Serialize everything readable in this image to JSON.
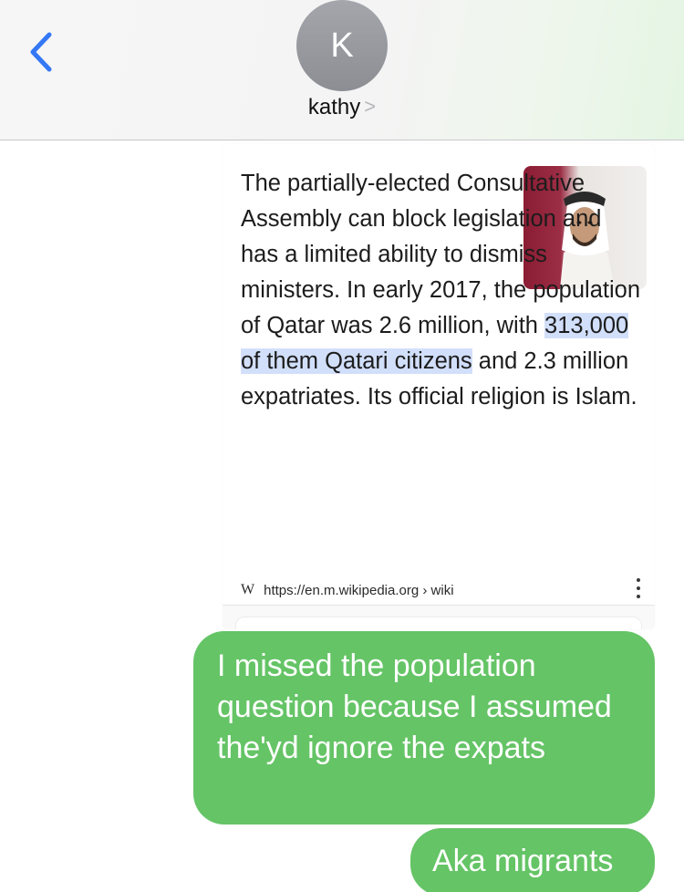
{
  "header": {
    "back_icon": "chevron-left-icon",
    "avatar_initial": "K",
    "contact_name": "kathy",
    "contact_chevron": ">"
  },
  "colors": {
    "accent_blue": "#3478f6",
    "bubble_green": "#65c466",
    "avatar_gray": "#9a9ca2",
    "highlight": "#d2dffb"
  },
  "shared_card": {
    "text_before_highlight": "The partially-elected Consultative Assembly can block legislation and has a limited ability to dismiss ministers. In early 2017, the population of Qatar was 2.6 million, with ",
    "text_highlight": "313,000 of them Qatari citizens",
    "text_after_highlight": " and 2.3 million expatriates. Its official religion is Islam.",
    "source_icon": "W",
    "source_url": "https://en.m.wikipedia.org › wiki",
    "more_icon": "more-vertical-icon"
  },
  "messages": [
    {
      "text": "I missed the population question because I assumed the'yd ignore the expats",
      "sender": "me"
    },
    {
      "text": "Aka migrants",
      "sender": "me"
    }
  ]
}
